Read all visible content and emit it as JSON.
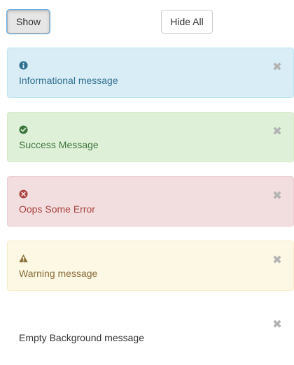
{
  "buttons": {
    "show_label": "Show",
    "hide_all_label": "Hide All"
  },
  "alerts": [
    {
      "type": "info",
      "icon": "info-circle-icon",
      "message": "Informational message",
      "background": "#d9edf7",
      "border": "#bce8f1",
      "text_color": "#31708f"
    },
    {
      "type": "success",
      "icon": "check-circle-icon",
      "message": "Success Message",
      "background": "#dff0d8",
      "border": "#d6e9c6",
      "text_color": "#3c763d"
    },
    {
      "type": "error",
      "icon": "x-circle-icon",
      "message": "Oops Some Error",
      "background": "#f2dede",
      "border": "#ebccd1",
      "text_color": "#a94442"
    },
    {
      "type": "warning",
      "icon": "warning-triangle-icon",
      "message": "Warning message",
      "background": "#fcf8e3",
      "border": "#faebcc",
      "text_color": "#8a6d3b"
    },
    {
      "type": "plain",
      "icon": "",
      "message": "Empty Background message",
      "background": "#ffffff",
      "border": "#ffffff",
      "text_color": "#333333"
    }
  ],
  "close_icon_color": "#b3b3b3"
}
